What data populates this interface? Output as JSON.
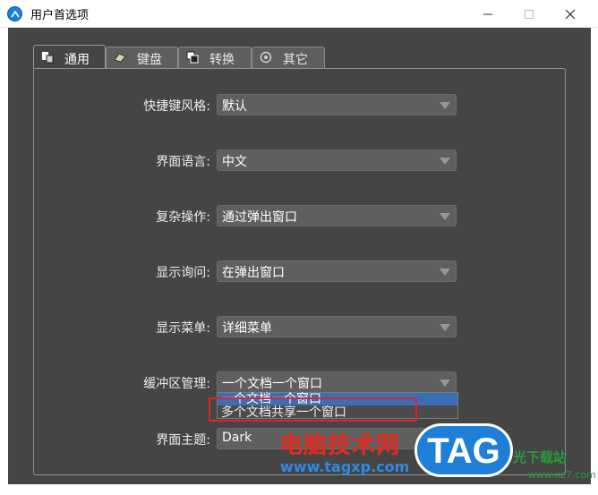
{
  "window": {
    "title": "用户首选项"
  },
  "tabs": [
    {
      "label": "通用",
      "icon": "general-icon",
      "active": true
    },
    {
      "label": "键盘",
      "icon": "keyboard-icon",
      "active": false
    },
    {
      "label": "转换",
      "icon": "convert-icon",
      "active": false
    },
    {
      "label": "其它",
      "icon": "gear-icon",
      "active": false
    }
  ],
  "settings": {
    "shortcut_style": {
      "label": "快捷键风格:",
      "value": "默认"
    },
    "ui_language": {
      "label": "界面语言:",
      "value": "中文"
    },
    "complex_ops": {
      "label": "复杂操作:",
      "value": "通过弹出窗口"
    },
    "show_prompt": {
      "label": "显示询问:",
      "value": "在弹出窗口"
    },
    "show_menu": {
      "label": "显示菜单:",
      "value": "详细菜单"
    },
    "buffer_mgmt": {
      "label": "缓冲区管理:",
      "value": "一个文档一个窗口"
    },
    "ui_theme": {
      "label": "界面主题:",
      "value": "Dark"
    }
  },
  "buffer_dropdown": {
    "options": [
      "一个文档一个窗口",
      "多个文档共享一个窗口"
    ],
    "selected_index": 0
  },
  "watermark": {
    "site_name": "电脑技术网",
    "url": "www.tagxp.com",
    "logo_text": "TAG",
    "corner_text": "光下载站",
    "corner_url": "www.xz7.com"
  },
  "colors": {
    "dialog_bg": "#454545",
    "highlight": "#e0232a",
    "selection": "#3a6fb5"
  }
}
